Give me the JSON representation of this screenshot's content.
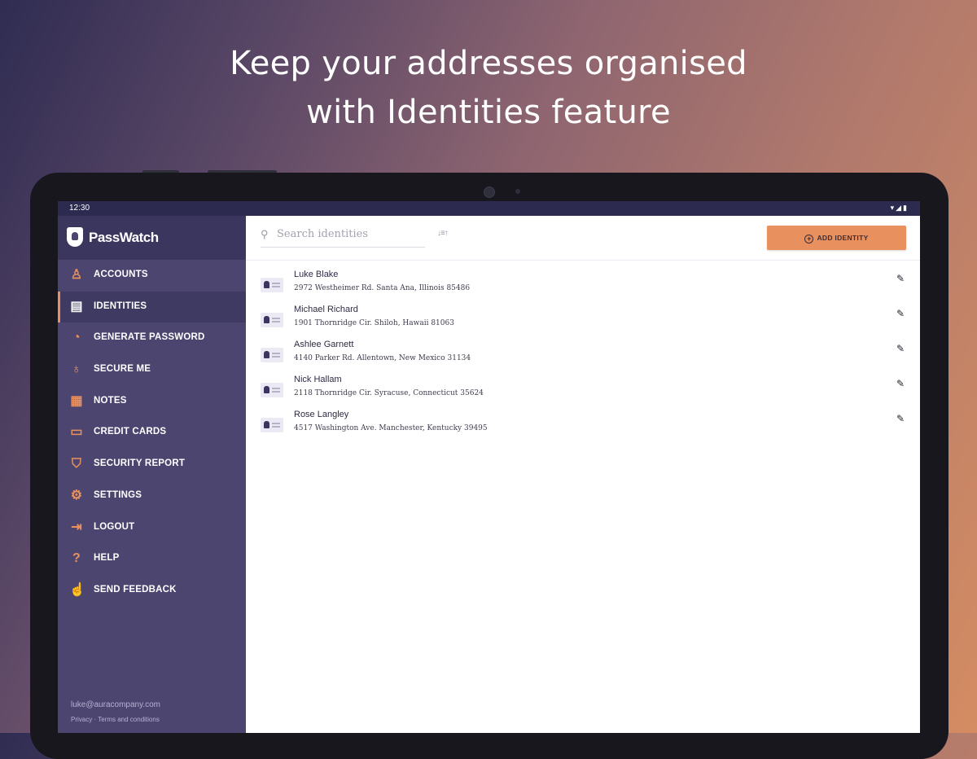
{
  "headline": {
    "line1": "Keep your addresses organised",
    "line2": "with Identities feature"
  },
  "statusbar": {
    "time": "12:30",
    "icons": [
      "wifi-icon",
      "signal-icon",
      "battery-icon"
    ]
  },
  "brand": {
    "name": "PassWatch",
    "icon": "shield-icon"
  },
  "sidebar": {
    "active_index": 1,
    "items": [
      {
        "label": "ACCOUNTS",
        "icon": "user-icon"
      },
      {
        "label": "IDENTITIES",
        "icon": "id-card-icon"
      },
      {
        "label": "GENERATE PASSWORD",
        "icon": "dial-icon"
      },
      {
        "label": "SECURE ME",
        "icon": "medal-icon"
      },
      {
        "label": "NOTES",
        "icon": "notes-icon"
      },
      {
        "label": "CREDIT CARDS",
        "icon": "credit-card-icon"
      },
      {
        "label": "SECURITY REPORT",
        "icon": "shield-check-icon"
      },
      {
        "label": "SETTINGS",
        "icon": "gear-icon"
      },
      {
        "label": "LOGOUT",
        "icon": "logout-icon"
      },
      {
        "label": "HELP",
        "icon": "help-icon"
      },
      {
        "label": "SEND FEEDBACK",
        "icon": "thumbs-up-icon"
      }
    ],
    "footer": {
      "email": "luke@auracompany.com",
      "privacy": "Privacy",
      "separator": "·",
      "terms": "Terms and conditions"
    }
  },
  "toolbar": {
    "search_placeholder": "Search identities",
    "sort_icon": "sort-icon",
    "add_label": "ADD IDENTITY"
  },
  "identities": [
    {
      "name": "Luke Blake",
      "address": "2972 Westheimer Rd. Santa Ana, Illinois 85486"
    },
    {
      "name": "Michael Richard",
      "address": "1901 Thornridge Cir. Shiloh, Hawaii 81063"
    },
    {
      "name": "Ashlee Garnett",
      "address": "4140 Parker Rd. Allentown, New Mexico 31134"
    },
    {
      "name": "Nick Hallam",
      "address": "2118 Thornridge Cir. Syracuse, Connecticut 35624"
    },
    {
      "name": "Rose Langley",
      "address": "4517 Washington Ave. Manchester, Kentucky 39495"
    }
  ],
  "colors": {
    "accent": "#e9905f",
    "sidebar": "#4c4570",
    "sidebar_header": "#3b365d"
  }
}
